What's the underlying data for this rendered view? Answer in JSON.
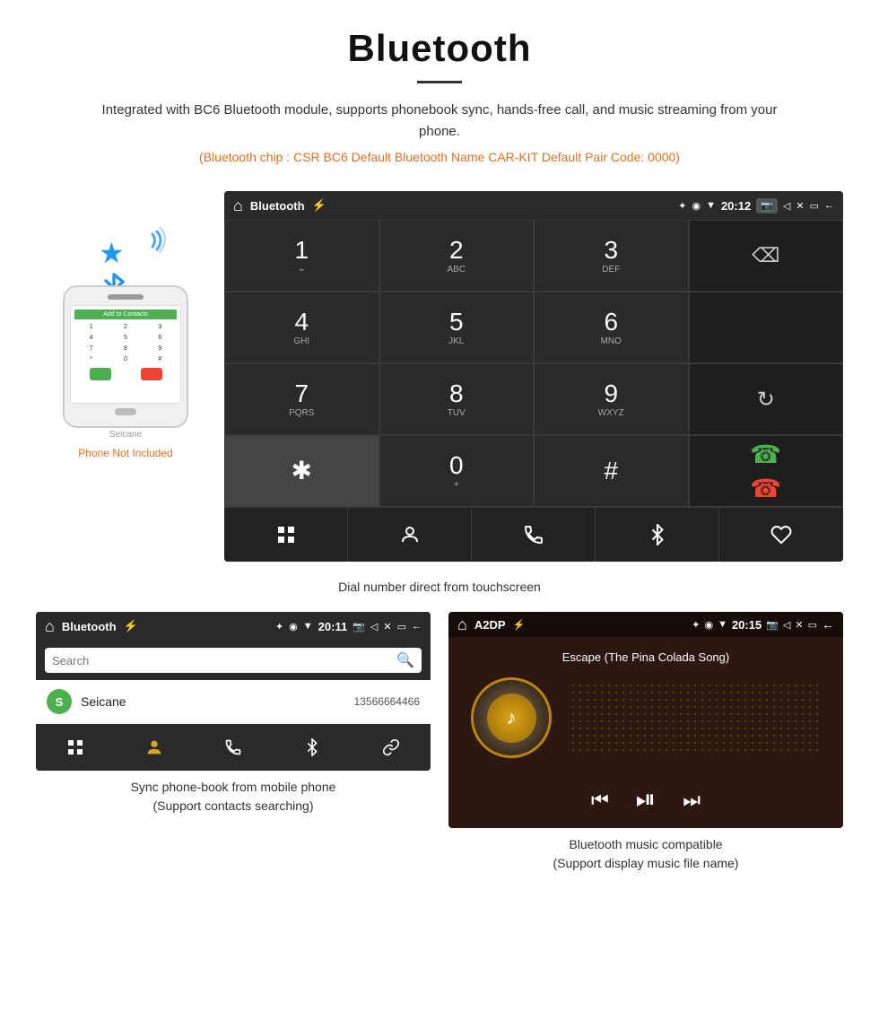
{
  "header": {
    "title": "Bluetooth",
    "description": "Integrated with BC6 Bluetooth module, supports phonebook sync, hands-free call, and music streaming from your phone.",
    "specs": "(Bluetooth chip : CSR BC6    Default Bluetooth Name CAR-KIT    Default Pair Code: 0000)"
  },
  "dialpad_screen": {
    "status_bar": {
      "app_name": "Bluetooth",
      "time": "20:12"
    },
    "keys": [
      {
        "main": "1",
        "sub": "⌣⌣"
      },
      {
        "main": "2",
        "sub": "ABC"
      },
      {
        "main": "3",
        "sub": "DEF"
      },
      {
        "main": "",
        "sub": ""
      },
      {
        "main": "4",
        "sub": "GHI"
      },
      {
        "main": "5",
        "sub": "JKL"
      },
      {
        "main": "6",
        "sub": "MNO"
      },
      {
        "main": "",
        "sub": ""
      },
      {
        "main": "7",
        "sub": "PQRS"
      },
      {
        "main": "8",
        "sub": "TUV"
      },
      {
        "main": "9",
        "sub": "WXYZ"
      },
      {
        "main": "↺",
        "sub": ""
      },
      {
        "main": "✱",
        "sub": ""
      },
      {
        "main": "0",
        "sub": "+"
      },
      {
        "main": "#",
        "sub": ""
      },
      {
        "main": "",
        "sub": ""
      }
    ],
    "caption": "Dial number direct from touchscreen"
  },
  "phonebook_screen": {
    "status_bar": {
      "app_name": "Bluetooth",
      "time": "20:11"
    },
    "search_placeholder": "Search",
    "contacts": [
      {
        "initial": "S",
        "name": "Seicane",
        "number": "13566664466"
      }
    ],
    "caption_line1": "Sync phone-book from mobile phone",
    "caption_line2": "(Support contacts searching)"
  },
  "music_screen": {
    "status_bar": {
      "app_name": "A2DP",
      "time": "20:15"
    },
    "song_title": "Escape (The Pina Colada Song)",
    "caption_line1": "Bluetooth music compatible",
    "caption_line2": "(Support display music file name)"
  },
  "phone": {
    "not_included": "Phone Not Included",
    "brand": "Seicane"
  },
  "icons": {
    "bluetooth": "₿",
    "home": "⌂",
    "back": "←",
    "usb": "⚡",
    "wifi_signal": "▼",
    "location": "◉",
    "bluetooth_status": "✦",
    "camera": "📷",
    "volume": "◁",
    "close": "✕",
    "screen": "▭",
    "dialpad_grid": "⊞",
    "person": "👤",
    "phone_handset": "☎",
    "bluetooth_icon": "⚡",
    "link": "🔗",
    "search": "🔍",
    "skip_prev": "⏮",
    "play_pause": "⏯",
    "skip_next": "⏭"
  }
}
